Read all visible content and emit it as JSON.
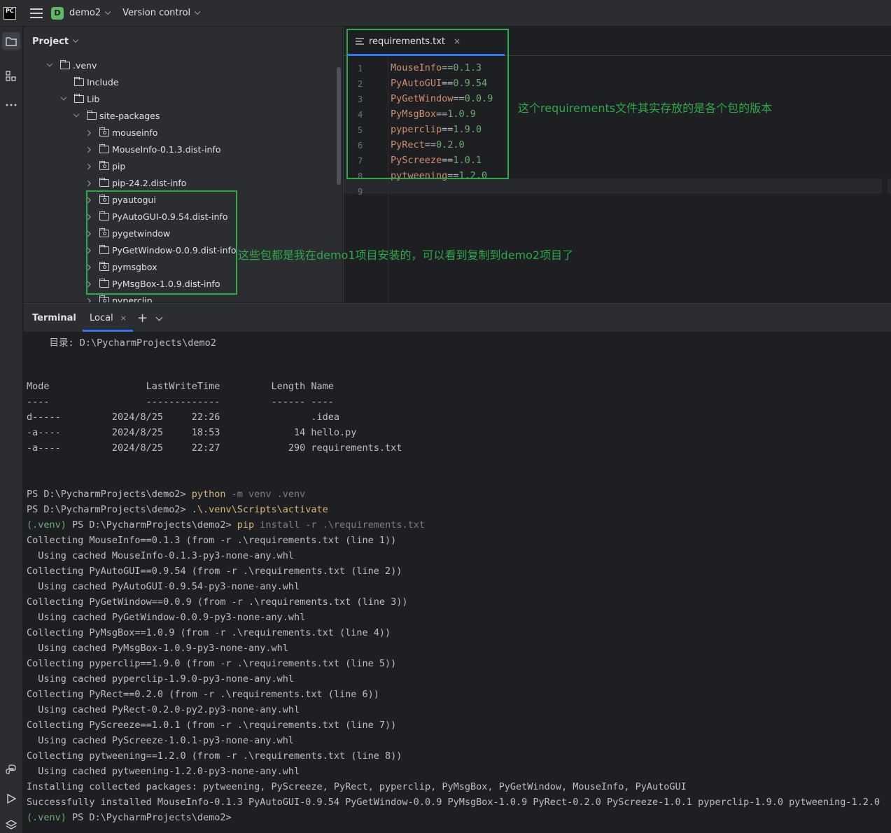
{
  "topbar": {
    "logo": "PC",
    "project_badge": "D",
    "project_name": "demo2",
    "vcs_label": "Version control"
  },
  "toolstrip": {
    "icons": [
      "folder-icon",
      "structure-icon",
      "more-icon",
      "python-console-icon",
      "run-icon",
      "layers-icon"
    ]
  },
  "project_panel": {
    "title": "Project",
    "tree": [
      {
        "label": ".venv",
        "depth": 1,
        "expanded": true,
        "icon": "folder"
      },
      {
        "label": "Include",
        "depth": 2,
        "expanded": null,
        "icon": "folder"
      },
      {
        "label": "Lib",
        "depth": 2,
        "expanded": true,
        "icon": "folder"
      },
      {
        "label": "site-packages",
        "depth": 3,
        "expanded": true,
        "icon": "folder"
      },
      {
        "label": "mouseinfo",
        "depth": 4,
        "expanded": false,
        "icon": "package"
      },
      {
        "label": "MouseInfo-0.1.3.dist-info",
        "depth": 4,
        "expanded": false,
        "icon": "folder"
      },
      {
        "label": "pip",
        "depth": 4,
        "expanded": false,
        "icon": "package"
      },
      {
        "label": "pip-24.2.dist-info",
        "depth": 4,
        "expanded": false,
        "icon": "folder"
      },
      {
        "label": "pyautogui",
        "depth": 4,
        "expanded": false,
        "icon": "package"
      },
      {
        "label": "PyAutoGUI-0.9.54.dist-info",
        "depth": 4,
        "expanded": false,
        "icon": "folder"
      },
      {
        "label": "pygetwindow",
        "depth": 4,
        "expanded": false,
        "icon": "package"
      },
      {
        "label": "PyGetWindow-0.0.9.dist-info",
        "depth": 4,
        "expanded": false,
        "icon": "folder"
      },
      {
        "label": "pymsgbox",
        "depth": 4,
        "expanded": false,
        "icon": "package"
      },
      {
        "label": "PyMsgBox-1.0.9.dist-info",
        "depth": 4,
        "expanded": false,
        "icon": "folder"
      },
      {
        "label": "pyperclip",
        "depth": 4,
        "expanded": false,
        "icon": "package"
      }
    ]
  },
  "editor": {
    "tab_label": "requirements.txt",
    "tab_close": "×",
    "lines": [
      {
        "num": "1",
        "pkg": "MouseInfo",
        "op": "==",
        "ver": "0.1.3"
      },
      {
        "num": "2",
        "pkg": "PyAutoGUI",
        "op": "==",
        "ver": "0.9.54"
      },
      {
        "num": "3",
        "pkg": "PyGetWindow",
        "op": "==",
        "ver": "0.0.9"
      },
      {
        "num": "4",
        "pkg": "PyMsgBox",
        "op": "==",
        "ver": "1.0.9"
      },
      {
        "num": "5",
        "pkg": "pyperclip",
        "op": "==",
        "ver": "1.9.0"
      },
      {
        "num": "6",
        "pkg": "PyRect",
        "op": "==",
        "ver": "0.2.0"
      },
      {
        "num": "7",
        "pkg": "PyScreeze",
        "op": "==",
        "ver": "1.0.1"
      },
      {
        "num": "8",
        "pkg": "pytweening",
        "op": "==",
        "ver": "1.2.0"
      },
      {
        "num": "9",
        "pkg": "",
        "op": "",
        "ver": ""
      }
    ]
  },
  "annotations": {
    "requirements_note": "这个requirements文件其实存放的是各个包的版本",
    "packages_note": "这些包都是我在demo1项目安装的，可以看到复制到demo2项目了",
    "color": "#2ea84b"
  },
  "terminal": {
    "title": "Terminal",
    "tab_label": "Local",
    "tab_close": "×",
    "new_tab": "+",
    "lines": [
      [
        {
          "t": "    目录: D:\\PycharmProjects\\demo2",
          "c": ""
        }
      ],
      [
        {
          "t": "",
          "c": ""
        }
      ],
      [
        {
          "t": "",
          "c": ""
        }
      ],
      [
        {
          "t": "Mode                 LastWriteTime         Length Name",
          "c": ""
        }
      ],
      [
        {
          "t": "----                 -------------         ------ ----",
          "c": ""
        }
      ],
      [
        {
          "t": "d-----         2024/8/25     22:26                .idea",
          "c": ""
        }
      ],
      [
        {
          "t": "-a----         2024/8/25     18:53             14 hello.py",
          "c": ""
        }
      ],
      [
        {
          "t": "-a----         2024/8/25     22:27            290 requirements.txt",
          "c": ""
        }
      ],
      [
        {
          "t": "",
          "c": ""
        }
      ],
      [
        {
          "t": "",
          "c": ""
        }
      ],
      [
        {
          "t": "PS D:\\PycharmProjects\\demo2> ",
          "c": ""
        },
        {
          "t": "python",
          "c": "cmd"
        },
        {
          "t": " -m venv .venv",
          "c": "arg"
        }
      ],
      [
        {
          "t": "PS D:\\PycharmProjects\\demo2> ",
          "c": ""
        },
        {
          "t": ".\\.venv\\Scripts\\activate",
          "c": "cmd"
        }
      ],
      [
        {
          "t": "(.venv)",
          "c": "ver"
        },
        {
          "t": " PS D:\\PycharmProjects\\demo2> ",
          "c": ""
        },
        {
          "t": "pip",
          "c": "cmd"
        },
        {
          "t": " install -r .\\requirements.txt",
          "c": "arg"
        }
      ],
      [
        {
          "t": "Collecting MouseInfo==0.1.3 (from -r .\\requirements.txt (line 1))",
          "c": ""
        }
      ],
      [
        {
          "t": "  Using cached MouseInfo-0.1.3-py3-none-any.whl",
          "c": ""
        }
      ],
      [
        {
          "t": "Collecting PyAutoGUI==0.9.54 (from -r .\\requirements.txt (line 2))",
          "c": ""
        }
      ],
      [
        {
          "t": "  Using cached PyAutoGUI-0.9.54-py3-none-any.whl",
          "c": ""
        }
      ],
      [
        {
          "t": "Collecting PyGetWindow==0.0.9 (from -r .\\requirements.txt (line 3))",
          "c": ""
        }
      ],
      [
        {
          "t": "  Using cached PyGetWindow-0.0.9-py3-none-any.whl",
          "c": ""
        }
      ],
      [
        {
          "t": "Collecting PyMsgBox==1.0.9 (from -r .\\requirements.txt (line 4))",
          "c": ""
        }
      ],
      [
        {
          "t": "  Using cached PyMsgBox-1.0.9-py3-none-any.whl",
          "c": ""
        }
      ],
      [
        {
          "t": "Collecting pyperclip==1.9.0 (from -r .\\requirements.txt (line 5))",
          "c": ""
        }
      ],
      [
        {
          "t": "  Using cached pyperclip-1.9.0-py3-none-any.whl",
          "c": ""
        }
      ],
      [
        {
          "t": "Collecting PyRect==0.2.0 (from -r .\\requirements.txt (line 6))",
          "c": ""
        }
      ],
      [
        {
          "t": "  Using cached PyRect-0.2.0-py2.py3-none-any.whl",
          "c": ""
        }
      ],
      [
        {
          "t": "Collecting PyScreeze==1.0.1 (from -r .\\requirements.txt (line 7))",
          "c": ""
        }
      ],
      [
        {
          "t": "  Using cached PyScreeze-1.0.1-py3-none-any.whl",
          "c": ""
        }
      ],
      [
        {
          "t": "Collecting pytweening==1.2.0 (from -r .\\requirements.txt (line 8))",
          "c": ""
        }
      ],
      [
        {
          "t": "  Using cached pytweening-1.2.0-py3-none-any.whl",
          "c": ""
        }
      ],
      [
        {
          "t": "Installing collected packages: pytweening, PyScreeze, PyRect, pyperclip, PyMsgBox, PyGetWindow, MouseInfo, PyAutoGUI",
          "c": ""
        }
      ],
      [
        {
          "t": "Successfully installed MouseInfo-0.1.3 PyAutoGUI-0.9.54 PyGetWindow-0.0.9 PyMsgBox-1.0.9 PyRect-0.2.0 PyScreeze-1.0.1 pyperclip-1.9.0 pytweening-1.2.0",
          "c": ""
        }
      ],
      [
        {
          "t": "(.venv)",
          "c": "ver"
        },
        {
          "t": " PS D:\\PycharmProjects\\demo2>",
          "c": ""
        }
      ]
    ]
  }
}
